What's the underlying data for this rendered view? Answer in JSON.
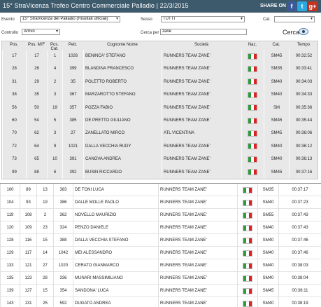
{
  "header": {
    "title": "15° StraVicenza Trofeo Centro Commerciale Palladio   |  22/3/2015",
    "share_label": "SHARE ON",
    "social": [
      "f",
      "t",
      "g+"
    ]
  },
  "filters": {
    "evento_label": "Evento",
    "evento_value": "15° StraVicenza del Palladio (Risultati ufficiali)",
    "sesso_label": "Sesso",
    "sesso_value": "TUTTI",
    "cat_label": "Cat.",
    "cat_value": "",
    "controllo_label": "Controllo",
    "controllo_value": "Arrivo",
    "cerca_per_label": "Cerca per",
    "cerca_per_value": "zane",
    "cerca_label": "Cerca"
  },
  "columns": [
    "Pos.",
    "Pos. M/F",
    "Pos. Cat.",
    "Pett.",
    "Cognome Nome",
    "Società",
    "Naz.",
    "Cat.",
    "Tempo"
  ],
  "top_rows": [
    [
      "17",
      "17",
      "1",
      "1026",
      "BENINCA' STEFANO",
      "RUNNERS TEAM ZANE'",
      "SM45",
      "00:32:52"
    ],
    [
      "28",
      "26",
      "4",
      "399",
      "BLANDINA FRANCESCO",
      "RUNNERS TEAM ZANE'",
      "SM35",
      "00:33:41"
    ],
    [
      "31",
      "29",
      "2",
      "35",
      "POLETTO ROBERTO",
      "RUNNERS TEAM ZANE'",
      "SM40",
      "00:34:03"
    ],
    [
      "38",
      "35",
      "3",
      "367",
      "MARZAROTTO STEFANO",
      "RUNNERS TEAM ZANE'",
      "SM40",
      "00:34:33"
    ],
    [
      "56",
      "50",
      "19",
      "357",
      "POZZA FABIO",
      "RUNNERS TEAM ZANE'",
      "SM",
      "00:35:36"
    ],
    [
      "60",
      "54",
      "5",
      "385",
      "DE PRETTO GIULIANO",
      "RUNNERS TEAM ZANE'",
      "SM45",
      "00:35:44"
    ],
    [
      "70",
      "62",
      "3",
      "27",
      "ZANELLATO MIRCO",
      "ATL VICENTINA",
      "SM45",
      "00:36:06"
    ],
    [
      "72",
      "64",
      "9",
      "1021",
      "DALLA VECCHIA RUDY",
      "RUNNERS TEAM ZANE'",
      "SM40",
      "00:36:12"
    ],
    [
      "73",
      "65",
      "10",
      "391",
      "CANOVA ANDREA",
      "RUNNERS TEAM ZANE'",
      "SM40",
      "00:36:13"
    ],
    [
      "99",
      "88",
      "6",
      "392",
      "BUSIN RICCARDO",
      "RUNNERS TEAM ZANE'",
      "SM45",
      "00:37:16"
    ]
  ],
  "bottom_rows": [
    [
      "100",
      "89",
      "13",
      "383",
      "DE TONI LUCA",
      "RUNNERS TEAM ZANE'",
      "SM35",
      "00:37:17"
    ],
    [
      "104",
      "93",
      "19",
      "386",
      "DALLE MOLLE PAOLO",
      "RUNNERS TEAM ZANE'",
      "SM40",
      "00:37:23"
    ],
    [
      "119",
      "108",
      "2",
      "362",
      "NOVELLO MAURIZIO",
      "RUNNERS TEAM ZANE'",
      "SM55",
      "00:37:43"
    ],
    [
      "120",
      "109",
      "23",
      "324",
      "PENZO DANIELE",
      "RUNNERS TEAM ZANE'",
      "SM40",
      "00:37:43"
    ],
    [
      "128",
      "116",
      "15",
      "388",
      "DALLA VECCHIA STEFANO",
      "RUNNERS TEAM ZANE'",
      "SM40",
      "00:37:46"
    ],
    [
      "129",
      "117",
      "14",
      "1042",
      "MEI ALESSANDRO",
      "RUNNERS TEAM ZANE'",
      "SM40",
      "00:37:46"
    ],
    [
      "133",
      "121",
      "27",
      "1020",
      "CERATO GIANMARCO",
      "RUNNERS TEAM ZANE'",
      "SM40",
      "00:38:03"
    ],
    [
      "135",
      "123",
      "28",
      "336",
      "MUNARI MASSIMILIANO",
      "RUNNERS TEAM ZANE'",
      "SM40",
      "00:38:04"
    ],
    [
      "139",
      "127",
      "15",
      "354",
      "SANDONA' LUCA",
      "RUNNERS TEAM ZANE'",
      "SM45",
      "00:38:11"
    ],
    [
      "143",
      "131",
      "25",
      "592",
      "DUGATO ANDREA",
      "RUNNERS TEAM ZANE'",
      "SM40",
      "00:38:19"
    ]
  ]
}
